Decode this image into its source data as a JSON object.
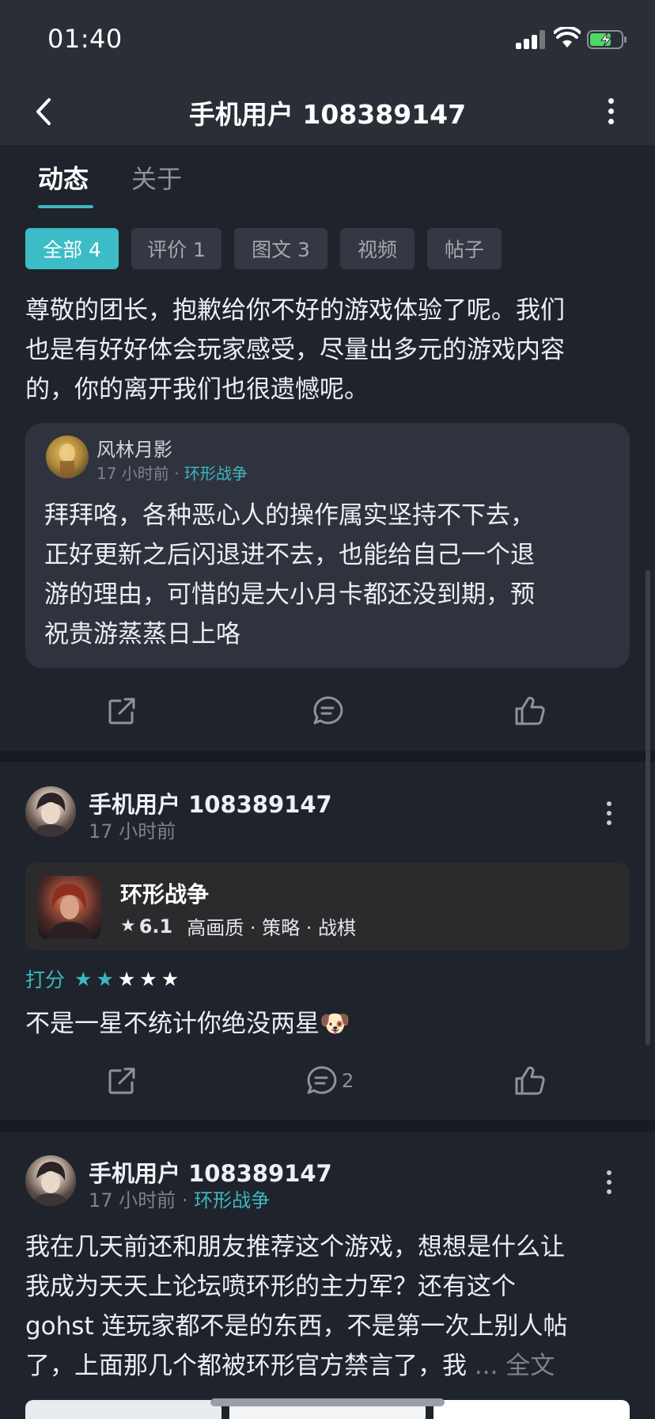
{
  "status_bar": {
    "time": "01:40"
  },
  "nav": {
    "title": "手机用户 108389147"
  },
  "tabs": [
    {
      "label": "动态",
      "active": true
    },
    {
      "label": "关于",
      "active": false
    }
  ],
  "filters": [
    {
      "label": "全部 4",
      "active": true
    },
    {
      "label": "评价 1",
      "active": false
    },
    {
      "label": "图文 3",
      "active": false
    },
    {
      "label": "视频",
      "active": false
    },
    {
      "label": "帖子",
      "active": false
    }
  ],
  "post1": {
    "reply_lines": [
      "尊敬的团长，抱歉给你不好的游戏体验了呢。我们",
      "也是有好好体会玩家感受，尽量出多元的游戏内容",
      "的，你的离开我们也很遗憾呢。"
    ],
    "quote": {
      "author": "风林月影",
      "time": "17 小时前",
      "dot": "·",
      "game": "环形战争",
      "lines": [
        "拜拜咯，各种恶心人的操作属实坚持不下去，",
        "正好更新之后闪退进不去，也能给自己一个退",
        "游的理由，可惜的是大小月卡都还没到期，预",
        "祝贵游蒸蒸日上咯"
      ]
    }
  },
  "post2": {
    "user": "手机用户 108389147",
    "time": "17 小时前",
    "game": {
      "name": "环形战争",
      "score": "6.1",
      "tags": "高画质 · 策略 · 战棋"
    },
    "rating_label": "打分",
    "rating": 2,
    "rating_max": 5,
    "text": "不是一星不统计你绝没两星",
    "emoji": "🐶",
    "comment_count": "2"
  },
  "post3": {
    "user": "手机用户 108389147",
    "time": "17 小时前",
    "dot": "·",
    "game": "环形战争",
    "lines": [
      "我在几天前还和朋友推荐这个游戏，想想是什么让",
      "我成为天天上论坛喷环形的主力军？还有这个",
      "gohst 连玩家都不是的东西，不是第一次上别人帖",
      "了，上面那几个都被环形官方禁言了，我"
    ],
    "more_label": "... 全文"
  },
  "colors": {
    "accent": "#3cb7c1",
    "background": "#1f232b",
    "header": "#2a2e37"
  },
  "icons": [
    "back-chevron-icon",
    "more-vertical-icon",
    "share-icon",
    "comment-icon",
    "like-icon",
    "star-icon"
  ]
}
